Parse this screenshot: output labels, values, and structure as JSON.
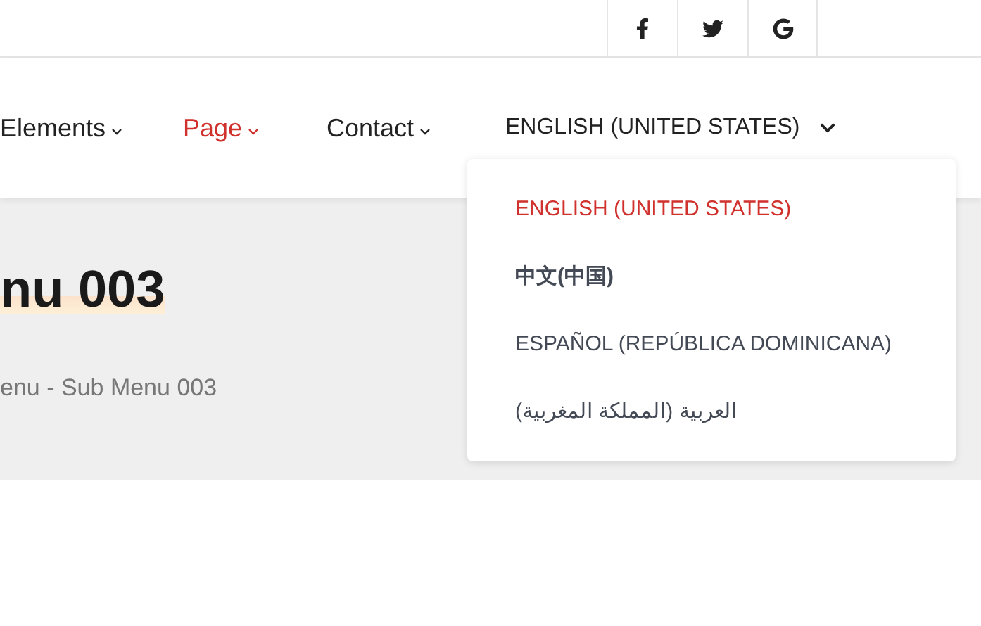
{
  "social": [
    {
      "kind": "facebook"
    },
    {
      "kind": "twitter"
    },
    {
      "kind": "google"
    }
  ],
  "nav": [
    {
      "label": "Elements",
      "selected": false
    },
    {
      "label": "Page",
      "selected": true
    },
    {
      "label": "Contact",
      "selected": false
    }
  ],
  "language": {
    "label": "ENGLISH (UNITED STATES)",
    "expanded": true,
    "options": [
      {
        "label": "ENGLISH (UNITED STATES)",
        "selected": true
      },
      {
        "label": "中文(中国)",
        "selected": false
      },
      {
        "label": "ESPAÑOL (REPÚBLICA DOMINICANA)",
        "selected": false
      },
      {
        "label": "العربية (المملكة المغربية)",
        "selected": false
      }
    ]
  },
  "page_title": "nu 003",
  "breadcrumb": "enu - Sub Menu 003"
}
